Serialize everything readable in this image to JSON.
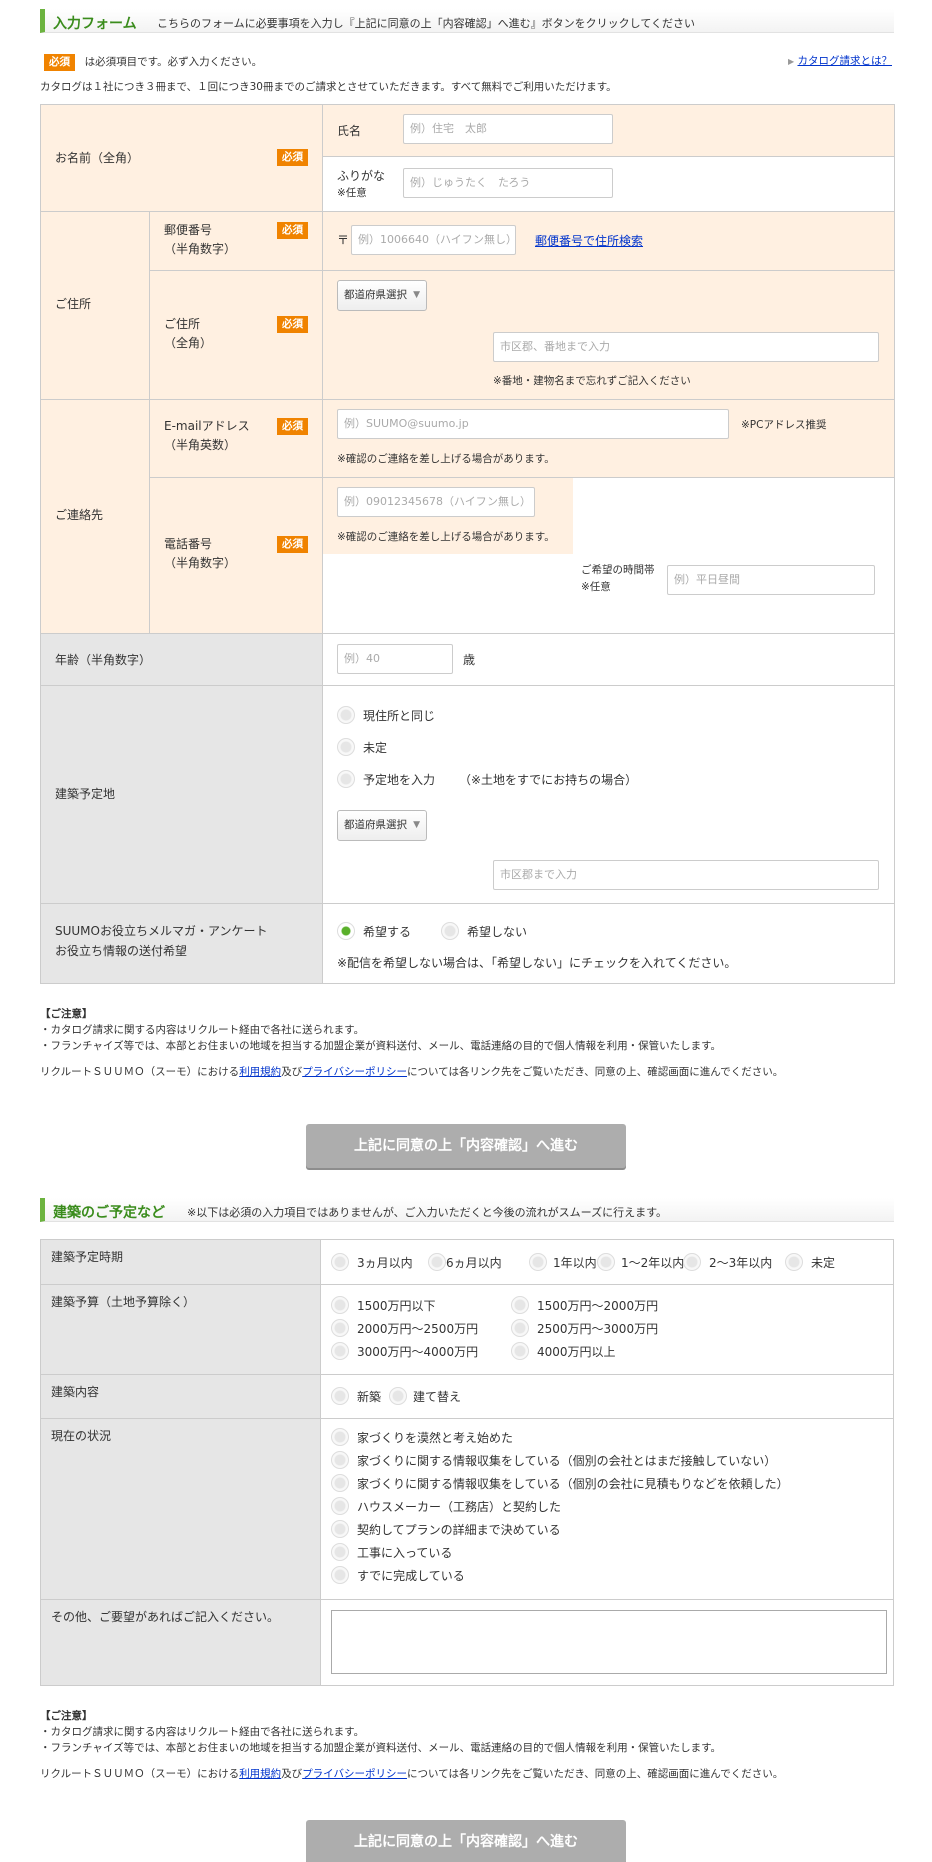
{
  "form": {
    "title": "入力フォーム",
    "instruction": "こちらのフォームに必要事項を入力し『上記に同意の上「内容確認」へ進む』ボタンをクリックしてください",
    "required_badge": "必須",
    "required_note": "は必須項目です。必ず入力ください。",
    "catalog_link": "カタログ請求とは？",
    "catalog_note": "カタログは１社につき３冊まで、１回につき30冊までのご請求とさせていただきます。すべて無料でご利用いただけます。",
    "name": {
      "label": "お名前（全角）",
      "full_label": "氏名",
      "full_placeholder": "例）住宅　太郎",
      "kana_label": "ふりがな",
      "kana_optional": "※任意",
      "kana_placeholder": "例）じゅうたく　たろう"
    },
    "address": {
      "label": "ご住所",
      "postal_label": "郵便番号",
      "postal_sub": "（半角数字）",
      "postal_mark": "〒",
      "postal_placeholder": "例）1006640（ハイフン無し）",
      "postal_search": "郵便番号で住所検索",
      "addr_label": "ご住所",
      "addr_sub": "（全角）",
      "pref_select": "都道府県選択",
      "city_placeholder": "市区郡、番地まで入力",
      "addr_note": "※番地・建物名まで忘れずご記入ください"
    },
    "contact": {
      "label": "ご連絡先",
      "email_label": "E-mailアドレス",
      "email_sub": "（半角英数）",
      "email_placeholder": "例）SUUMO@suumo.jp",
      "email_pc": "※PCアドレス推奨",
      "email_note": "※確認のご連絡を差し上げる場合があります。",
      "tel_label": "電話番号",
      "tel_sub": "（半角数字）",
      "tel_placeholder": "例）09012345678（ハイフン無し）",
      "tel_note": "※確認のご連絡を差し上げる場合があります。",
      "time_label": "ご希望の時間帯",
      "time_optional": "※任意",
      "time_placeholder": "例）平日昼間"
    },
    "age": {
      "label": "年齢（半角数字）",
      "placeholder": "例）40",
      "unit": "歳"
    },
    "site": {
      "label": "建築予定地",
      "opt1": "現住所と同じ",
      "opt2": "未定",
      "opt3": "予定地を入力",
      "opt3_note": "（※土地をすでにお持ちの場合）",
      "pref_select": "都道府県選択",
      "city_placeholder": "市区郡まで入力"
    },
    "mail": {
      "label1": "SUUMOお役立ちメルマガ・アンケート",
      "label2": "お役立ち情報の送付希望",
      "yes": "希望する",
      "no": "希望しない",
      "note": "※配信を希望しない場合は、「希望しない」にチェックを入れてください。"
    }
  },
  "notice": {
    "title": "【ご注意】",
    "line1": "・カタログ請求に関する内容はリクルート経由で各社に送られます。",
    "line2": "・フランチャイズ等では、本部とお住まいの地域を担当する加盟企業が資料送付、メール、電話連絡の目的で個人情報を利用・保管いたします。",
    "agree_pre": "リクルートＳＵＵＭＯ（スーモ）における",
    "terms": "利用規約",
    "agree_and": "及び",
    "privacy": "プライバシーポリシー",
    "agree_post": "については各リンク先をご覧いただき、同意の上、確認画面に進んでください。"
  },
  "submit_label": "上記に同意の上「内容確認」へ進む",
  "plan": {
    "title": "建築のご予定など",
    "note": "※以下は必須の入力項目ではありませんが、ご入力いただくと今後の流れがスムーズに行えます。",
    "timing_label": "建築予定時期",
    "timing": [
      "3ヵ月以内",
      "6ヵ月以内",
      "1年以内",
      "1〜2年以内",
      "2〜3年以内",
      "未定"
    ],
    "budget_label": "建築予算（土地予算除く）",
    "budget": [
      "1500万円以下",
      "1500万円〜2000万円",
      "2000万円〜2500万円",
      "2500万円〜3000万円",
      "3000万円〜4000万円",
      "4000万円以上"
    ],
    "content_label": "建築内容",
    "content": [
      "新築",
      "建て替え"
    ],
    "status_label": "現在の状況",
    "status": [
      "家づくりを漠然と考え始めた",
      "家づくりに関する情報収集をしている（個別の会社とはまだ接触していない）",
      "家づくりに関する情報収集をしている（個別の会社に見積もりなどを依頼した）",
      "ハウスメーカー（工務店）と契約した",
      "契約してプランの詳細まで決めている",
      "工事に入っている",
      "すでに完成している"
    ],
    "other_label": "その他、ご要望があればご記入ください。"
  }
}
